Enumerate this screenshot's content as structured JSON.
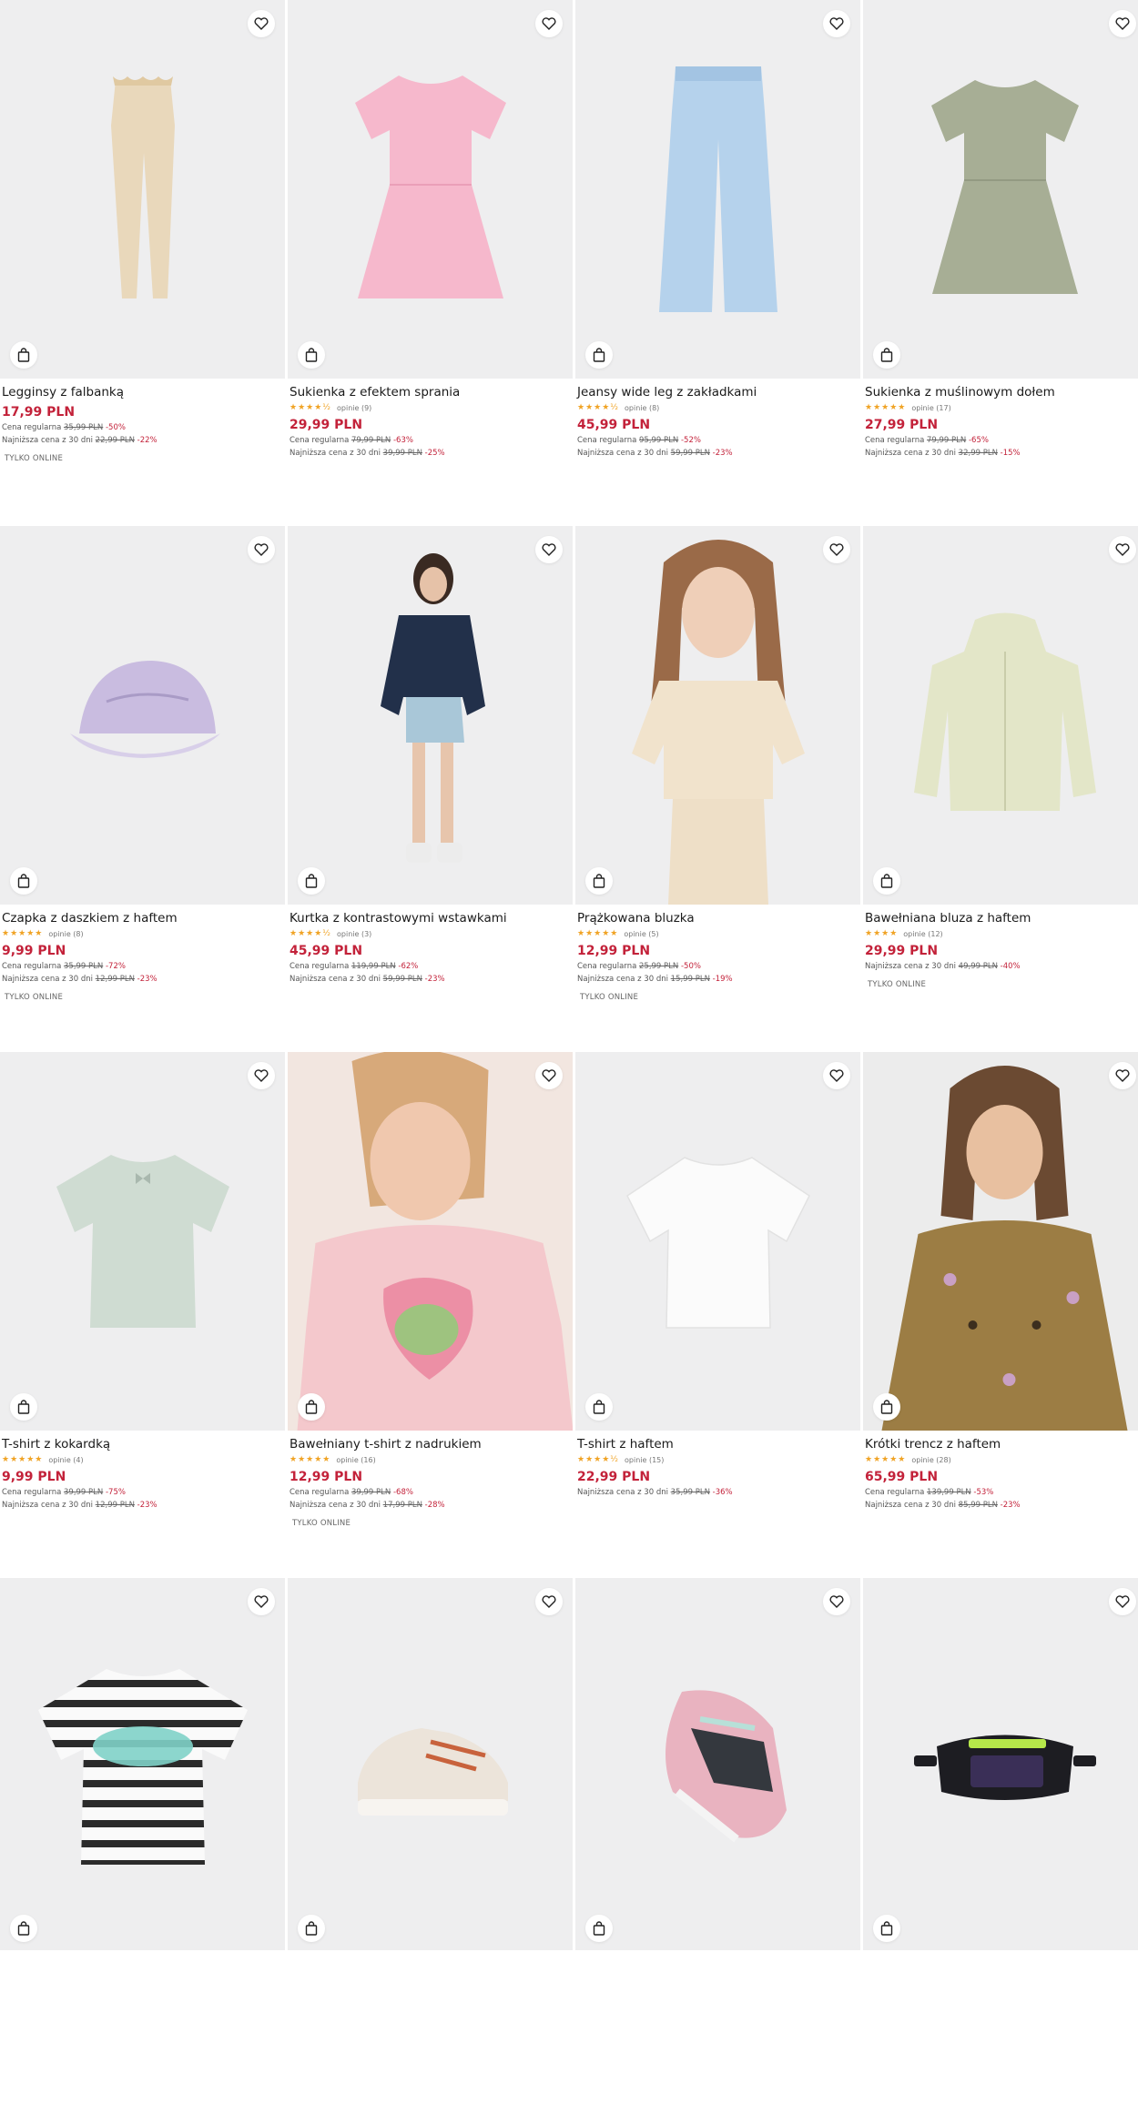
{
  "colors": {
    "price": "#c3223a",
    "star": "#f0a324",
    "image_bg": "#eeeeef"
  },
  "icons": {
    "favorite": "heart-icon",
    "cart": "shopping-bag-icon"
  },
  "products": [
    {
      "title": "Legginsy z falbanką",
      "price": "17,99 PLN",
      "regular_label": "Cena regularna",
      "regular_price": "35,99 PLN",
      "regular_discount": "-50%",
      "lowest_label": "Najniższa cena z 30 dni",
      "lowest_price": "22,99 PLN",
      "lowest_discount": "-22%",
      "badge": "TYLKO ONLINE"
    },
    {
      "title": "Sukienka z efektem sprania",
      "stars": "★★★★½",
      "reviews": "opinie (9)",
      "price": "29,99 PLN",
      "regular_label": "Cena regularna",
      "regular_price": "79,99 PLN",
      "regular_discount": "-63%",
      "lowest_label": "Najniższa cena z 30 dni",
      "lowest_price": "39,99 PLN",
      "lowest_discount": "-25%"
    },
    {
      "title": "Jeansy wide leg z zakładkami",
      "stars": "★★★★½",
      "reviews": "opinie (8)",
      "price": "45,99 PLN",
      "regular_label": "Cena regularna",
      "regular_price": "95,99 PLN",
      "regular_discount": "-52%",
      "lowest_label": "Najniższa cena z 30 dni",
      "lowest_price": "59,99 PLN",
      "lowest_discount": "-23%"
    },
    {
      "title": "Sukienka z muślinowym dołem",
      "stars": "★★★★★",
      "reviews": "opinie (17)",
      "price": "27,99 PLN",
      "regular_label": "Cena regularna",
      "regular_price": "79,99 PLN",
      "regular_discount": "-65%",
      "lowest_label": "Najniższa cena z 30 dni",
      "lowest_price": "32,99 PLN",
      "lowest_discount": "-15%"
    },
    {
      "title": "Czapka z daszkiem z haftem",
      "stars": "★★★★★",
      "reviews": "opinie (8)",
      "price": "9,99 PLN",
      "regular_label": "Cena regularna",
      "regular_price": "35,99 PLN",
      "regular_discount": "-72%",
      "lowest_label": "Najniższa cena z 30 dni",
      "lowest_price": "12,99 PLN",
      "lowest_discount": "-23%",
      "badge": "TYLKO ONLINE"
    },
    {
      "title": "Kurtka z kontrastowymi wstawkami",
      "stars": "★★★★½",
      "reviews": "opinie (3)",
      "price": "45,99 PLN",
      "regular_label": "Cena regularna",
      "regular_price": "119,99 PLN",
      "regular_discount": "-62%",
      "lowest_label": "Najniższa cena z 30 dni",
      "lowest_price": "59,99 PLN",
      "lowest_discount": "-23%"
    },
    {
      "title": "Prążkowana bluzka",
      "stars": "★★★★★",
      "reviews": "opinie (5)",
      "price": "12,99 PLN",
      "regular_label": "Cena regularna",
      "regular_price": "25,99 PLN",
      "regular_discount": "-50%",
      "lowest_label": "Najniższa cena z 30 dni",
      "lowest_price": "15,99 PLN",
      "lowest_discount": "-19%",
      "badge": "TYLKO ONLINE"
    },
    {
      "title": "Bawełniana bluza z haftem",
      "stars": "★★★★",
      "reviews": "opinie (12)",
      "price": "29,99 PLN",
      "lowest_label": "Najniższa cena z 30 dni",
      "lowest_price": "49,99 PLN",
      "lowest_discount": "-40%",
      "badge": "TYLKO ONLINE"
    },
    {
      "title": "T-shirt z kokardką",
      "stars": "★★★★★",
      "reviews": "opinie (4)",
      "price": "9,99 PLN",
      "regular_label": "Cena regularna",
      "regular_price": "39,99 PLN",
      "regular_discount": "-75%",
      "lowest_label": "Najniższa cena z 30 dni",
      "lowest_price": "12,99 PLN",
      "lowest_discount": "-23%"
    },
    {
      "title": "Bawełniany t-shirt z nadrukiem",
      "stars": "★★★★★",
      "reviews": "opinie (16)",
      "price": "12,99 PLN",
      "regular_label": "Cena regularna",
      "regular_price": "39,99 PLN",
      "regular_discount": "-68%",
      "lowest_label": "Najniższa cena z 30 dni",
      "lowest_price": "17,99 PLN",
      "lowest_discount": "-28%",
      "badge": "TYLKO ONLINE"
    },
    {
      "title": "T-shirt z haftem",
      "stars": "★★★★½",
      "reviews": "opinie (15)",
      "price": "22,99 PLN",
      "lowest_label": "Najniższa cena z 30 dni",
      "lowest_price": "35,99 PLN",
      "lowest_discount": "-36%"
    },
    {
      "title": "Krótki trencz z haftem",
      "stars": "★★★★★",
      "reviews": "opinie (28)",
      "price": "65,99 PLN",
      "regular_label": "Cena regularna",
      "regular_price": "139,99 PLN",
      "regular_discount": "-53%",
      "lowest_label": "Najniższa cena z 30 dni",
      "lowest_price": "85,99 PLN",
      "lowest_discount": "-23%"
    },
    {},
    {},
    {},
    {}
  ]
}
